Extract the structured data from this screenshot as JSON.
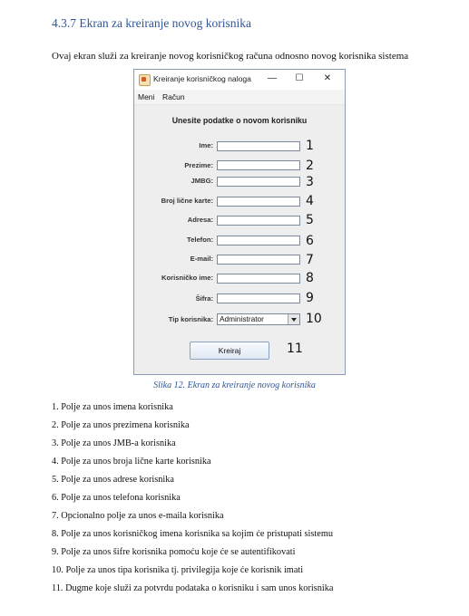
{
  "heading": "4.3.7 Ekran za kreiranje novog korisnika",
  "intro": "Ovaj ekran služi za kreiranje novog korisničkog računa odnosno novog korisnika sistema",
  "window": {
    "title": "Kreiranje korisničkog naloga",
    "controls": {
      "minimize": "—",
      "maximize": "☐",
      "close": "✕"
    },
    "menu": [
      "Meni",
      "Račun"
    ],
    "form_title": "Unesite podatke o novom korisniku",
    "fields": [
      {
        "label": "Ime:",
        "number": "1"
      },
      {
        "label": "Prezime:",
        "number": "2"
      },
      {
        "label": "JMBG:",
        "number": "3"
      },
      {
        "label": "Broj lične karte:",
        "number": "4"
      },
      {
        "label": "Adresa:",
        "number": "5"
      },
      {
        "label": "Telefon:",
        "number": "6"
      },
      {
        "label": "E-mail:",
        "number": "7"
      },
      {
        "label": "Korisničko ime:",
        "number": "8"
      },
      {
        "label": "Šifra:",
        "number": "9"
      }
    ],
    "user_type": {
      "label": "Tip korisnika:",
      "value": "Administrator",
      "number": "10"
    },
    "create_button": {
      "label": "Kreiraj",
      "number": "11"
    }
  },
  "caption": "Slika 12. Ekran za kreiranje novog korisnika",
  "list": [
    "1. Polje za unos imena korisnika",
    "2. Polje za unos prezimena korisnika",
    "3. Polje za unos JMB-a korisnika",
    "4. Polje za unos broja lične karte korisnika",
    "5. Polje za unos adrese korisnika",
    "6. Polje za unos telefona korisnika",
    "7. Opcionalno polje za unos e-maila korisnika",
    "8. Polje za unos korisničkog imena korisnika sa kojim će pristupati sistemu",
    "9. Polje za unos šifre korisnika pomoću koje će se autentifikovati",
    "10. Polje za unos tipa korisnika tj. privilegija koje će korisnik imati",
    "11. Dugme koje služi za potvrdu podataka o korisniku i sam unos korisnika"
  ]
}
